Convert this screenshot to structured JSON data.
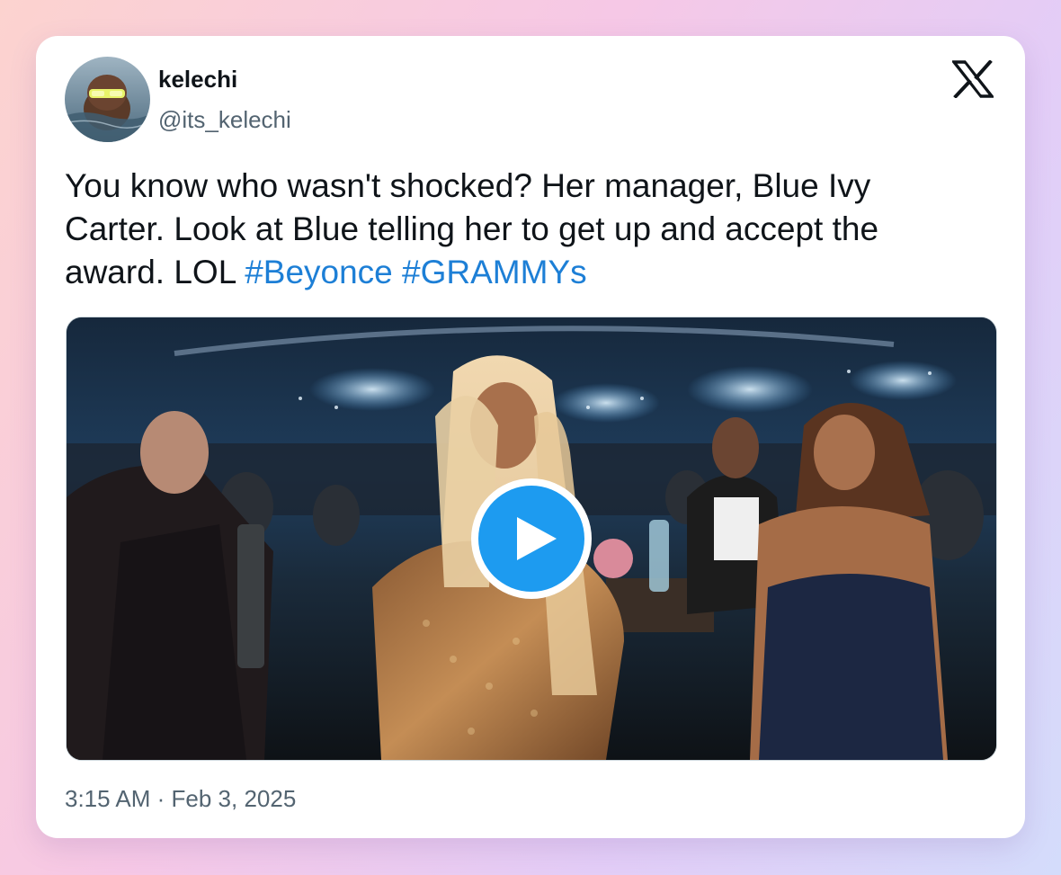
{
  "author": {
    "display_name": "kelechi",
    "handle": "@its_kelechi",
    "avatar_icon": "avatar-photo"
  },
  "platform": {
    "logo_icon": "x-logo-icon"
  },
  "tweet": {
    "text_before": "You know who wasn't shocked? Her manager, Blue Ivy Carter. Look at Blue telling her to get up and accept the award. LOL ",
    "hashtags": [
      "#Beyonce",
      "#GRAMMYs"
    ]
  },
  "media": {
    "type": "video",
    "play_icon": "play-icon"
  },
  "meta": {
    "time": "3:15 AM",
    "separator": " · ",
    "date": "Feb 3, 2025"
  },
  "colors": {
    "link": "#1d7fd6",
    "play_button": "#1d9bf0",
    "secondary_text": "#536471"
  }
}
